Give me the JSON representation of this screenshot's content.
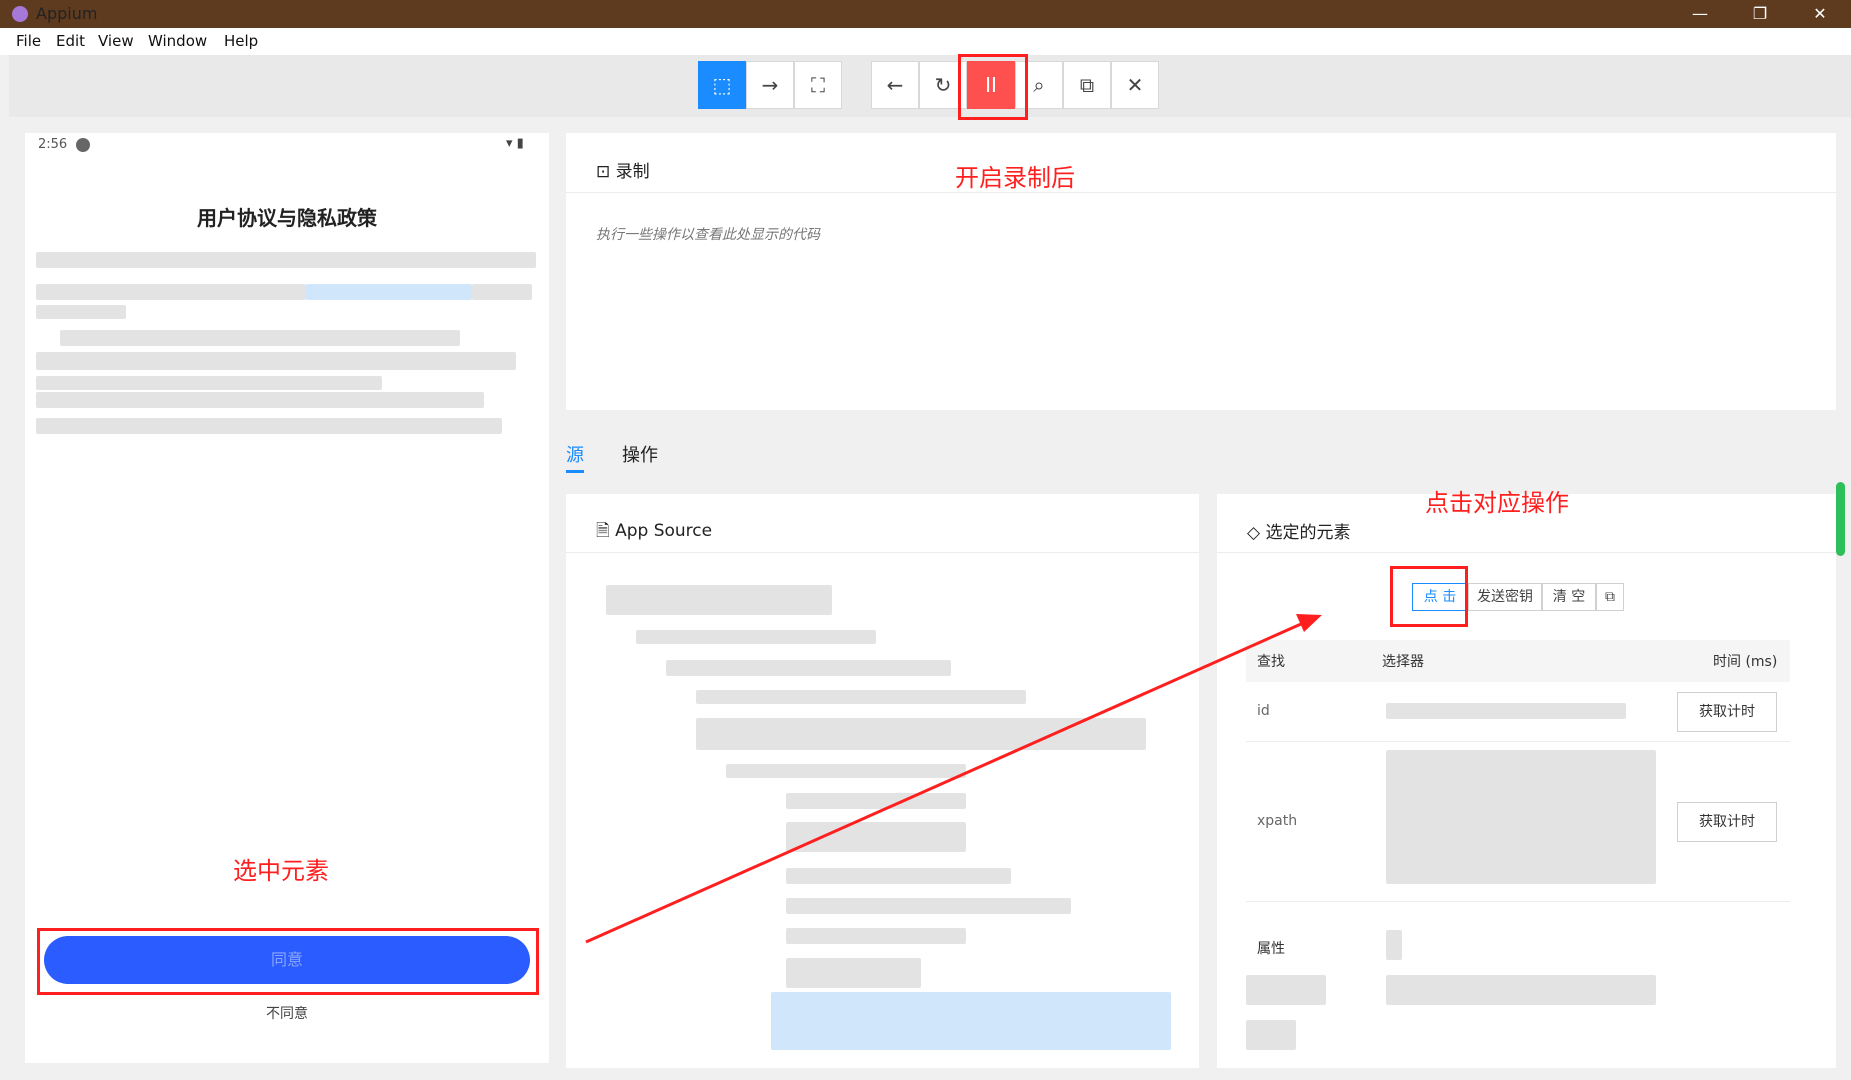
{
  "window": {
    "title": "Appium",
    "min": "—",
    "max": "❐",
    "close": "✕"
  },
  "menu": [
    "File",
    "Edit",
    "View",
    "Window",
    "Help"
  ],
  "toolbar": {
    "select": "⬚",
    "swipe": "→",
    "tap_coords": "⛶",
    "back": "←",
    "refresh": "↻",
    "pause_record": "II",
    "search": "⌕",
    "copy": "⧉",
    "quit": "✕"
  },
  "device": {
    "time": "2:56",
    "status_icons": "▾ ▮",
    "agreement_title": "用户协议与隐私政策",
    "agree_label": "同意",
    "disagree_label": "不同意"
  },
  "recorder": {
    "title": "录制",
    "icon": "⊡",
    "hint": "执行一些操作以查看此处显示的代码"
  },
  "tabs": {
    "source": "源",
    "actions": "操作"
  },
  "app_source": {
    "title": "App Source",
    "icon": "🗎"
  },
  "selected": {
    "title": "选定的元素",
    "icon": "◇",
    "actions": {
      "tap": "点 击",
      "send_keys": "发送密钥",
      "clear": "清 空",
      "copy": "⧉"
    },
    "headers": {
      "find": "查找",
      "selector": "选择器",
      "time": "时间 (ms)"
    },
    "rows": [
      {
        "strategy": "id",
        "button": "获取计时"
      },
      {
        "strategy": "xpath",
        "button": "获取计时"
      }
    ],
    "attributes_label": "属性"
  },
  "annotations": {
    "recording": "开启录制后",
    "select_element": "选中元素",
    "click_action": "点击对应操作"
  }
}
